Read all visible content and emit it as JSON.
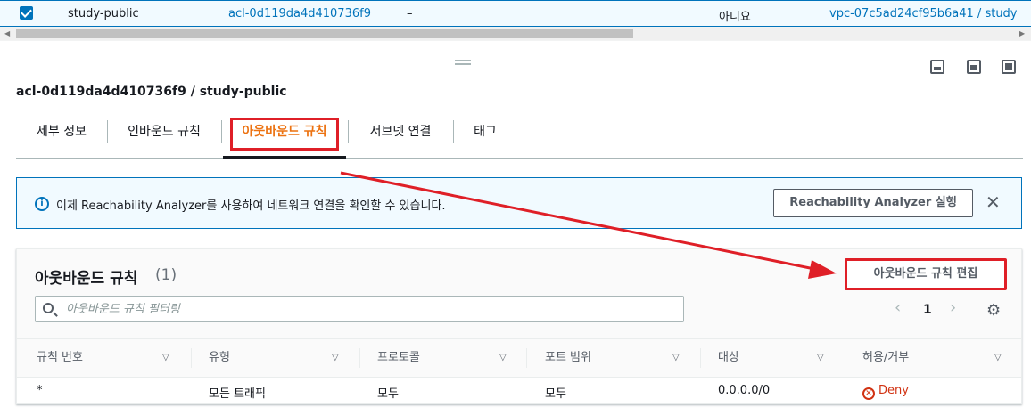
{
  "top_row": {
    "name": "study-public",
    "acl_id": "acl-0d119da4d410736f9",
    "dash": "–",
    "default": "아니요",
    "vpc": "vpc-07c5ad24cf95b6a41 / study"
  },
  "detail": {
    "title": "acl-0d119da4d410736f9 / study-public"
  },
  "tabs": [
    {
      "label": "세부 정보"
    },
    {
      "label": "인바운드 규칙"
    },
    {
      "label": "아웃바운드 규칙"
    },
    {
      "label": "서브넷 연결"
    },
    {
      "label": "태그"
    }
  ],
  "info_banner": {
    "text": "이제 Reachability Analyzer를 사용하여 네트워크 연결을 확인할 수 있습니다.",
    "button": "Reachability Analyzer 실행"
  },
  "rules": {
    "title": "아웃바운드 규칙",
    "count": "(1)",
    "edit_button": "아웃바운드 규칙 편집",
    "search_placeholder": "아웃바운드 규칙 필터링",
    "page": "1",
    "columns": [
      "규칙 번호",
      "유형",
      "프로토콜",
      "포트 범위",
      "대상",
      "허용/거부"
    ],
    "rows": [
      {
        "rule": "*",
        "type": "모든 트래픽",
        "protocol": "모두",
        "ports": "모두",
        "dest": "0.0.0.0/0",
        "action": "Deny"
      }
    ]
  },
  "colors": {
    "accent": "#0073bb",
    "active_tab": "#ec7211",
    "highlight": "#df1f27",
    "deny": "#d13212"
  }
}
